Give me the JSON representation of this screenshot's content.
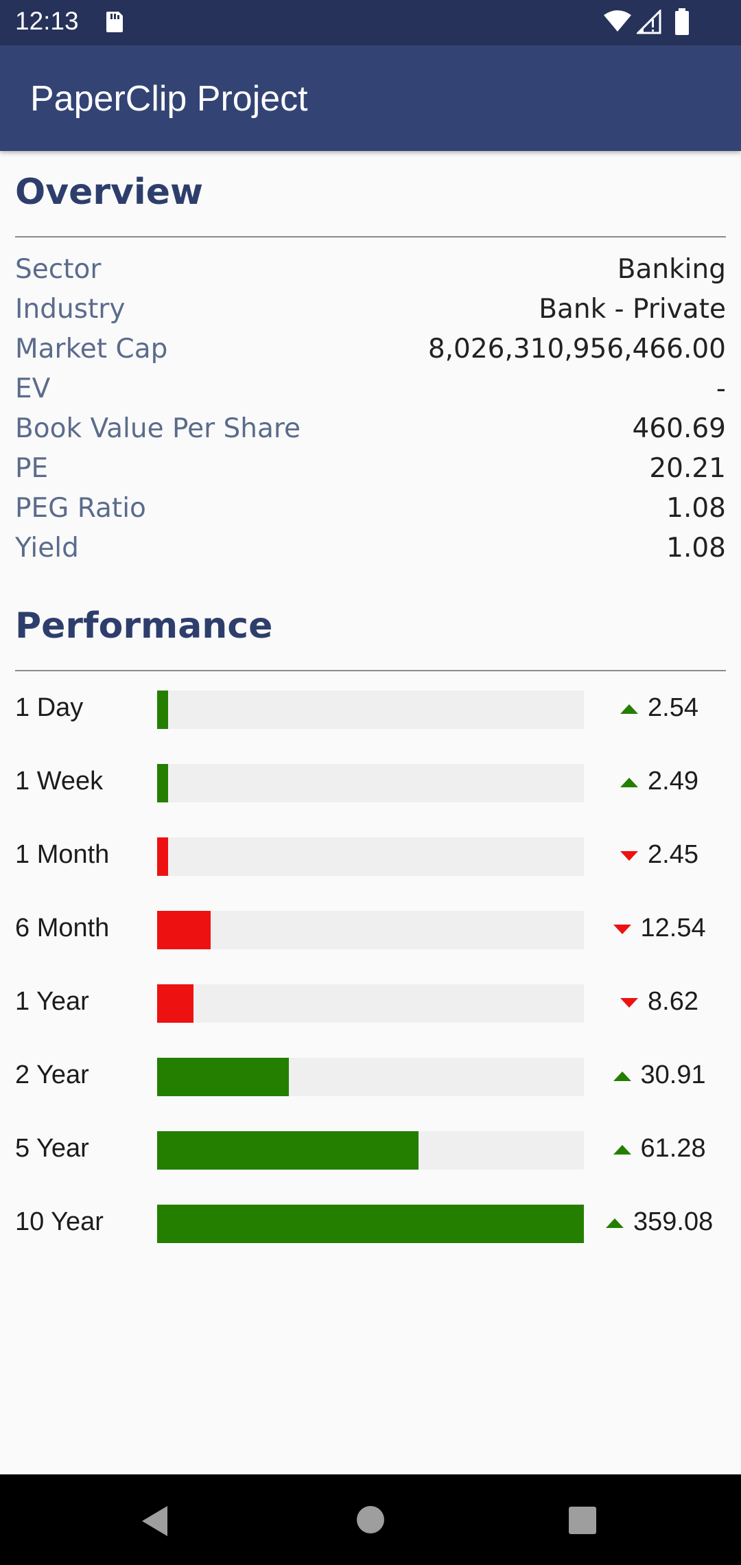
{
  "status_bar": {
    "time": "12:13"
  },
  "app_bar": {
    "title": "PaperClip Project"
  },
  "overview": {
    "title": "Overview",
    "rows": [
      {
        "label": "Sector",
        "value": "Banking"
      },
      {
        "label": "Industry",
        "value": "Bank - Private"
      },
      {
        "label": "Market Cap",
        "value": "8,026,310,956,466.00"
      },
      {
        "label": "EV",
        "value": "-"
      },
      {
        "label": "Book Value Per Share",
        "value": "460.69"
      },
      {
        "label": "PE",
        "value": "20.21"
      },
      {
        "label": "PEG Ratio",
        "value": "1.08"
      },
      {
        "label": "Yield",
        "value": "1.08"
      }
    ]
  },
  "performance": {
    "title": "Performance",
    "rows": [
      {
        "label": "1 Day",
        "value": "2.54",
        "direction": "up",
        "bar_fraction": 0.025
      },
      {
        "label": "1 Week",
        "value": "2.49",
        "direction": "up",
        "bar_fraction": 0.025
      },
      {
        "label": "1 Month",
        "value": "2.45",
        "direction": "down",
        "bar_fraction": 0.025
      },
      {
        "label": "6 Month",
        "value": "12.54",
        "direction": "down",
        "bar_fraction": 0.125
      },
      {
        "label": "1 Year",
        "value": "8.62",
        "direction": "down",
        "bar_fraction": 0.085
      },
      {
        "label": "2 Year",
        "value": "30.91",
        "direction": "up",
        "bar_fraction": 0.309
      },
      {
        "label": "5 Year",
        "value": "61.28",
        "direction": "up",
        "bar_fraction": 0.613
      },
      {
        "label": "10 Year",
        "value": "359.08",
        "direction": "up",
        "bar_fraction": 1.0
      }
    ]
  },
  "colors": {
    "positive": "#247f00",
    "negative": "#ee1111",
    "app_bar": "#334474",
    "status_bar": "#26325a"
  },
  "icons": [
    "sd-card-icon",
    "wifi-icon",
    "signal-icon",
    "battery-icon",
    "back-icon",
    "home-icon",
    "recents-icon"
  ]
}
